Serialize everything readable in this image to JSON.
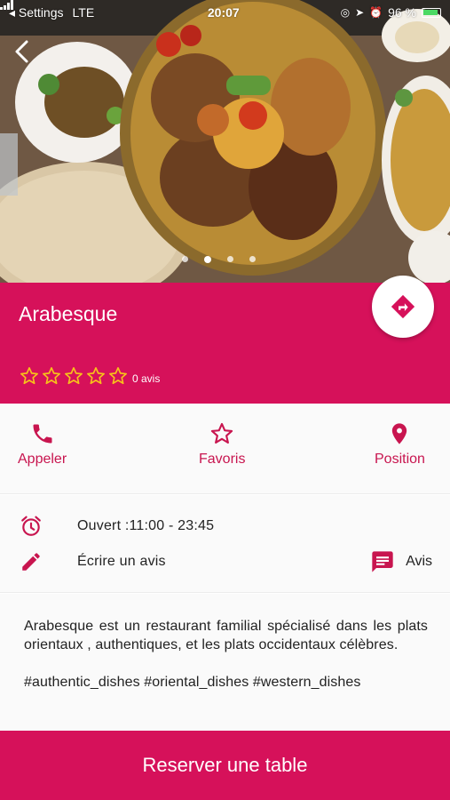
{
  "status_bar": {
    "carrier": "◂ Settings",
    "network": "LTE",
    "time": "20:07",
    "battery_text": "96 %"
  },
  "hero": {
    "carousel_dots": 4,
    "active_dot": 2
  },
  "restaurant": {
    "name": "Arabesque",
    "stars": 5,
    "rating_value": 0,
    "reviews_label": "0 avis"
  },
  "actions": [
    {
      "label": "Appeler",
      "icon": "phone-icon"
    },
    {
      "label": "Favoris",
      "icon": "star-outline-icon"
    },
    {
      "label": "Position",
      "icon": "location-pin-icon"
    }
  ],
  "info": {
    "hours": "Ouvert :11:00 - 23:45",
    "write_review": "Écrire un avis",
    "reviews_button": "Avis"
  },
  "description": {
    "text": "Arabesque est un restaurant familial spécialisé dans les plats orientaux , authentiques, et les plats occidentaux célèbres.",
    "tags": "#authentic_dishes #oriental_dishes  #western_dishes"
  },
  "cta": {
    "label": "Reserver une table"
  },
  "colors": {
    "accent": "#d6115a",
    "icon": "#c8154f",
    "star": "#f7c21a"
  }
}
